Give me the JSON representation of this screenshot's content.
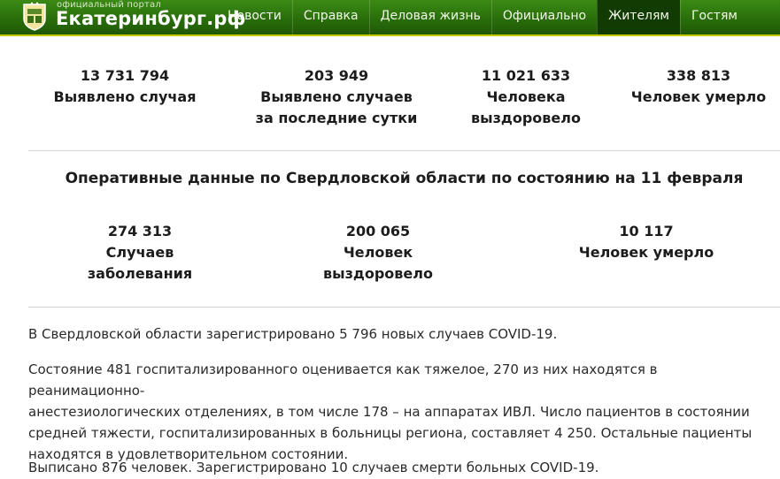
{
  "header": {
    "logo_small": "официальный портал",
    "logo_big": "Екатеринбург.рф",
    "nav": [
      {
        "label": "Новости",
        "active": false
      },
      {
        "label": "Справка",
        "active": false
      },
      {
        "label": "Деловая жизнь",
        "active": false
      },
      {
        "label": "Официально",
        "active": false
      },
      {
        "label": "Жителям",
        "active": true
      },
      {
        "label": "Гостям",
        "active": false
      }
    ]
  },
  "russia_stats": [
    {
      "value": "13 731 794",
      "line1": "Выявлено случая",
      "line2": ""
    },
    {
      "value": "203 949",
      "line1": "Выявлено случаев",
      "line2": "за последние сутки"
    },
    {
      "value": "11 021 633",
      "line1": "Человека",
      "line2": "выздоровело"
    },
    {
      "value": "338 813",
      "line1": "Человек умерло",
      "line2": ""
    }
  ],
  "region_title": "Оперативные данные по Свердловской области по состоянию на 11 февраля",
  "region_stats": [
    {
      "value": "274 313",
      "line1": "Случаев",
      "line2": "заболевания"
    },
    {
      "value": "200 065",
      "line1": "Человек",
      "line2": "выздоровело"
    },
    {
      "value": "10 117",
      "line1": "Человек умерло",
      "line2": ""
    }
  ],
  "article": {
    "p1": "В Свердловской области зарегистрировано 5 796 новых случаев COVID-19.",
    "p2_lines": [
      "Состояние 481 госпитализированного оценивается как тяжелое, 270 из них находятся в реанимационно-",
      "анестезиологических отделениях, в том числе 178 – на аппаратах ИВЛ. Число пациентов в состоянии",
      "средней тяжести, госпитализированных в больницы региона, составляет 4 250. Остальные пациенты",
      "находятся в удовлетворительном состоянии."
    ],
    "p3": "Выписано 876 человек. Зарегистрировано 10 случаев смерти больных COVID-19."
  },
  "colors": {
    "header_green": "#2a6e0b",
    "active_tab": "#123b03",
    "accent_line": "#c9c900"
  }
}
